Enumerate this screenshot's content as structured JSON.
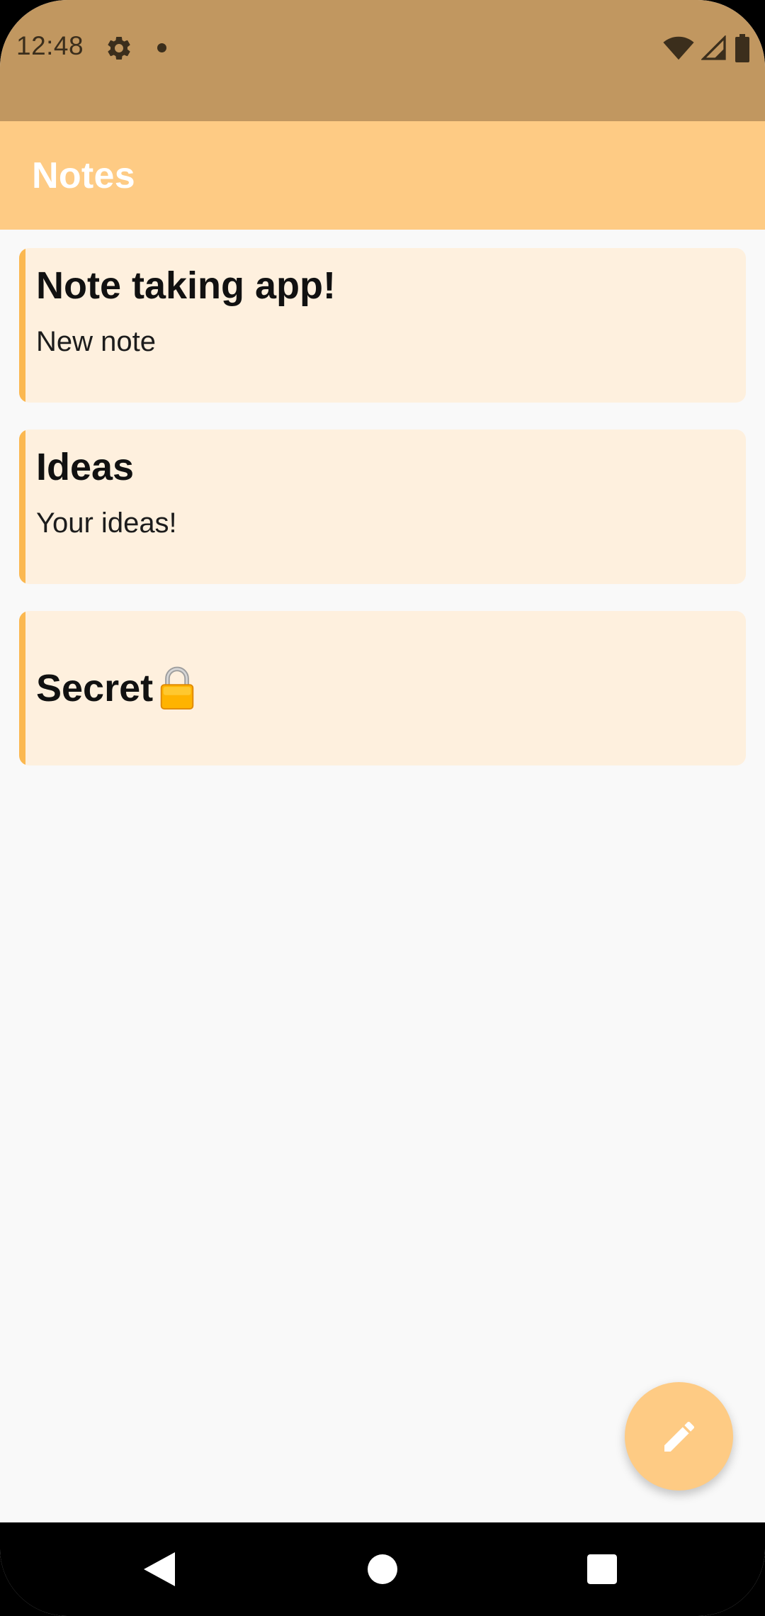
{
  "status_bar": {
    "time": "12:48",
    "icons": [
      "gear-icon",
      "notification-dot-icon",
      "wifi-icon",
      "cell-signal-icon",
      "battery-icon"
    ]
  },
  "app_bar": {
    "title": "Notes"
  },
  "notes": [
    {
      "title": "Note taking app!",
      "body": "New note"
    },
    {
      "title": "Ideas",
      "body": "Your ideas!"
    },
    {
      "title": "Secret",
      "body": "",
      "icon": "lock-icon"
    }
  ],
  "fab": {
    "icon": "pencil-icon"
  },
  "nav_bar": {
    "icons": [
      "back-icon",
      "home-icon",
      "recents-icon"
    ]
  },
  "colors": {
    "status_bar": "#c19760",
    "app_bar": "#fecb84",
    "card": "#fef0de",
    "card_accent": "#fbb850",
    "background": "#f9f9f9"
  }
}
